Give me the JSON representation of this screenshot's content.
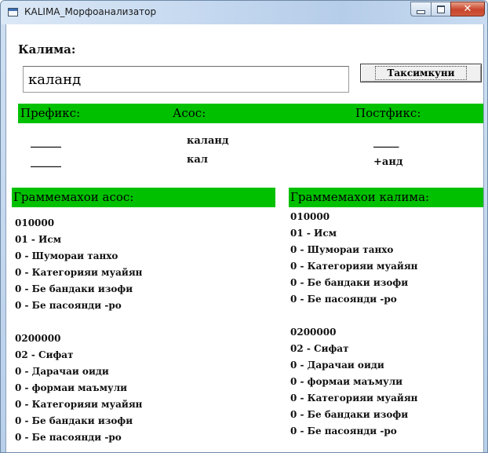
{
  "window": {
    "title": "КАLIMA_Морфоанализатор"
  },
  "colors": {
    "section_bar": "#00c000"
  },
  "labels": {
    "word": "Калима:",
    "analyze_button": "Таксимкуни"
  },
  "input": {
    "word_value": "каланд"
  },
  "sections": {
    "prefix": "Префикс:",
    "stem": "Асос:",
    "postfix": "Постфикс:",
    "stem_grammemes": "Граммемахои асос:",
    "word_grammemes": "Граммемахои калима:"
  },
  "prefix_values": [
    "______",
    "______"
  ],
  "stem_values": [
    "каланд",
    "кал"
  ],
  "postfix_values": [
    "_____",
    "+анд"
  ],
  "stem_grammemes": [
    "010000",
    "01 - Исм",
    "0 - Шумораи танхо",
    "0 - Категорияи муайян",
    "0 - Бе бандаки изофи",
    "0 - Бе пасоянди -ро",
    "",
    "0200000",
    "02 - Сифат",
    "0 - Дарачаи оиди",
    "0 - формаи маъмули",
    "0 - Категорияи муайян",
    "0 - Бе бандаки изофи",
    "0 - Бе пасоянди -ро"
  ],
  "word_grammemes": [
    "010000",
    "01 - Исм",
    "0 - Шумораи танхо",
    "0 - Категорияи муайян",
    "0 - Бе бандаки изофи",
    "0 - Бе пасоянди -ро",
    "",
    "0200000",
    "02 - Сифат",
    "0 - Дарачаи оиди",
    "0 - формаи маъмули",
    "0 - Категорияи муайян",
    "0 - Бе бандаки изофи",
    "0 - Бе пасоянди -ро"
  ]
}
